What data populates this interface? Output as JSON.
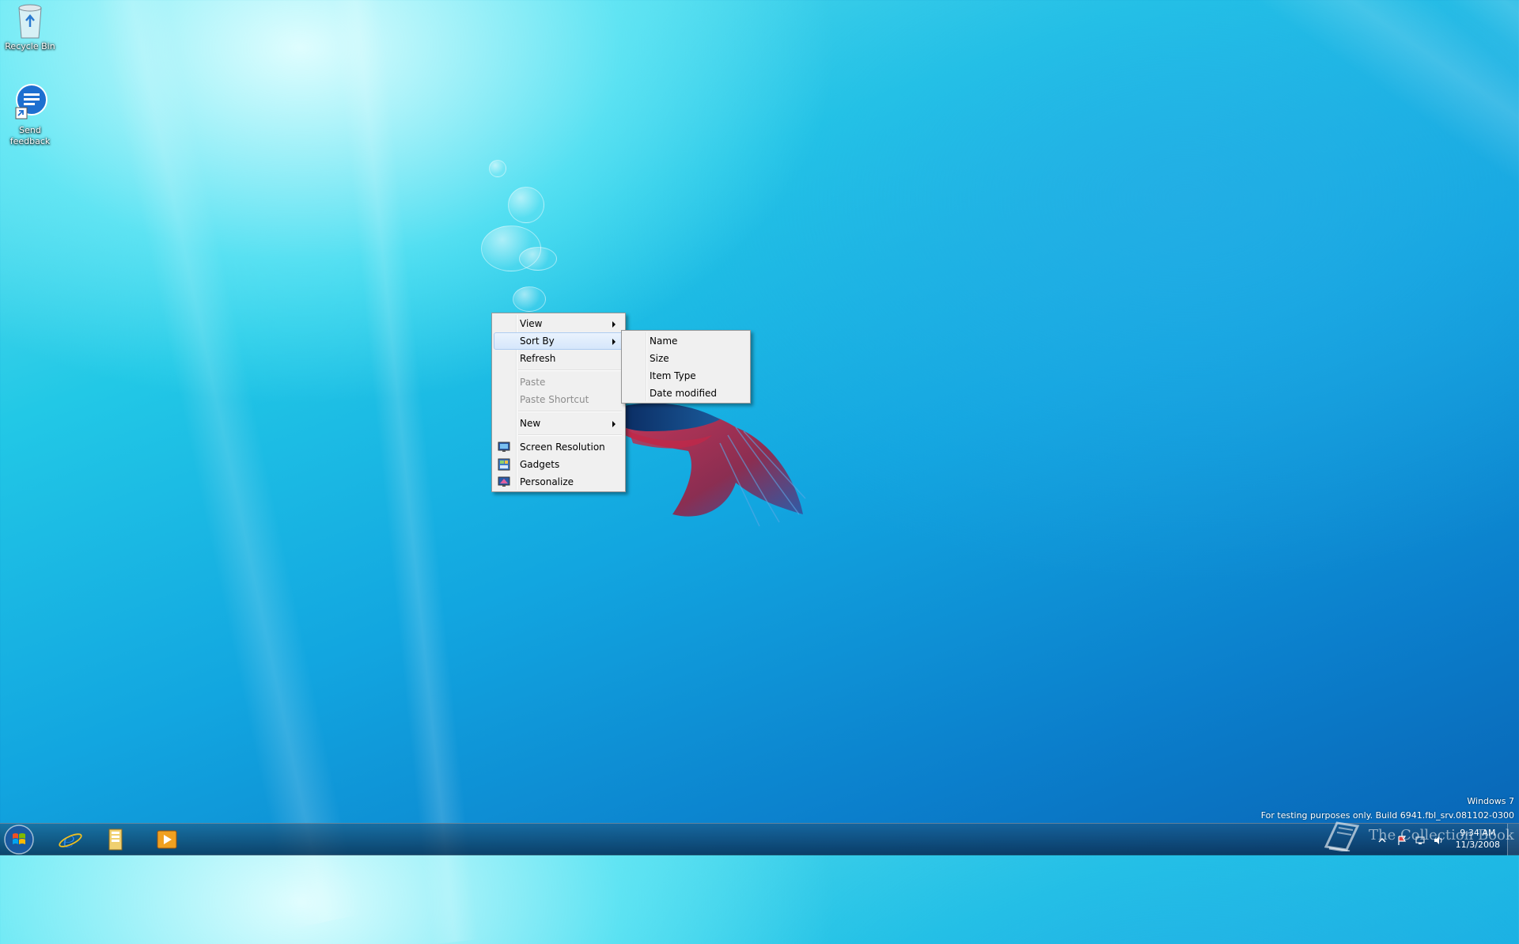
{
  "desktop": {
    "icons": [
      {
        "label": "Recycle Bin"
      },
      {
        "label": "Send\nfeedback"
      }
    ]
  },
  "context_menu": {
    "items": [
      {
        "label": "View",
        "has_submenu": true
      },
      {
        "label": "Sort By",
        "has_submenu": true,
        "highlighted": true
      },
      {
        "label": "Refresh"
      },
      {
        "label": "Paste",
        "disabled": true
      },
      {
        "label": "Paste Shortcut",
        "disabled": true
      },
      {
        "label": "New",
        "has_submenu": true
      },
      {
        "label": "Screen Resolution",
        "icon": "screen-resolution-icon"
      },
      {
        "label": "Gadgets",
        "icon": "gadgets-icon"
      },
      {
        "label": "Personalize",
        "icon": "personalize-icon"
      }
    ]
  },
  "sort_by_submenu": {
    "items": [
      {
        "label": "Name"
      },
      {
        "label": "Size"
      },
      {
        "label": "Item Type"
      },
      {
        "label": "Date modified"
      }
    ]
  },
  "watermark": {
    "line1": "Windows 7",
    "line2": "For testing purposes only. Build 6941.fbl_srv.081102-0300"
  },
  "brand_overlay": "The Collection Book",
  "taskbar": {
    "pinned": [
      "start-orb",
      "internet-explorer-icon",
      "windows-explorer-icon",
      "media-player-icon"
    ],
    "clock_time": "9:34 AM",
    "clock_date": "11/3/2008"
  },
  "colors": {
    "menu_bg": "#f0f0f0",
    "menu_border": "#979797",
    "highlight": "#d5e6fb",
    "disabled_text": "#8d8d8d"
  }
}
